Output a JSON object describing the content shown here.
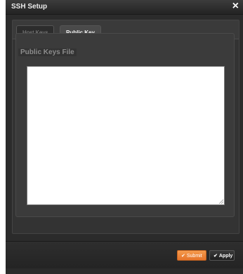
{
  "dialog": {
    "title": "SSH Setup",
    "close_glyph": "×"
  },
  "tabs": [
    {
      "label": "Host Keys",
      "active": false
    },
    {
      "label": "Public Key",
      "active": true
    }
  ],
  "public_key_panel": {
    "legend": "Public Keys File",
    "textarea_value": ""
  },
  "footer": {
    "submit_label": "Submit",
    "apply_label": "Apply",
    "check_glyph": "✔"
  },
  "colors": {
    "accent": "#e5742a",
    "dialog_bg": "#2b2b2b"
  },
  "icons": {
    "close": "close-icon",
    "check": "check-icon",
    "resize": "resize-grip-icon"
  }
}
